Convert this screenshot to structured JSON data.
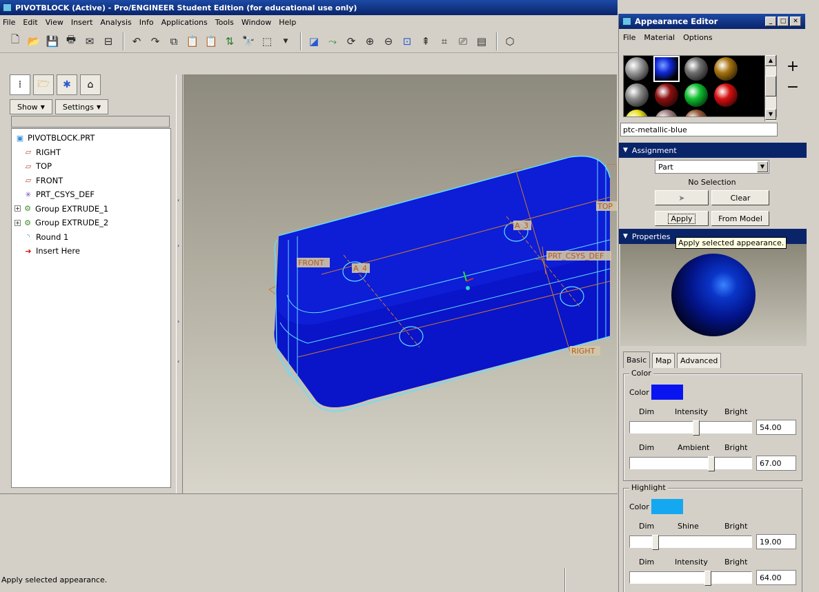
{
  "window": {
    "title": "PIVOTBLOCK (Active) - Pro/ENGINEER Student Edition (for educational use only)",
    "menus": [
      "File",
      "Edit",
      "View",
      "Insert",
      "Analysis",
      "Info",
      "Applications",
      "Tools",
      "Window",
      "Help"
    ]
  },
  "toolbar": {
    "icons": [
      "new-file-icon",
      "open-folder-icon",
      "save-icon",
      "print-icon",
      "email-icon",
      "close-window-icon",
      "undo-icon",
      "redo-icon",
      "copy-icon",
      "paste-icon",
      "paste-special-icon",
      "regenerate-icon",
      "find-icon",
      "select-box-icon",
      "repaint-icon",
      "spin-center-icon",
      "orient-icon",
      "zoom-in-icon",
      "zoom-out-icon",
      "refit-icon",
      "datum-axis-icon",
      "annotation-icon",
      "layer-icon",
      "model-tree-icon"
    ]
  },
  "navigator": {
    "show_label": "Show",
    "settings_label": "Settings",
    "tree": [
      {
        "label": "PIVOTBLOCK.PRT",
        "icon": "part-icon",
        "level": 0,
        "expander": false,
        "color": "#3a8fd9"
      },
      {
        "label": "RIGHT",
        "icon": "datum-plane-icon",
        "level": 1,
        "expander": false,
        "color": "#b8451a"
      },
      {
        "label": "TOP",
        "icon": "datum-plane-icon",
        "level": 1,
        "expander": false,
        "color": "#b8451a"
      },
      {
        "label": "FRONT",
        "icon": "datum-plane-icon",
        "level": 1,
        "expander": false,
        "color": "#b8451a"
      },
      {
        "label": "PRT_CSYS_DEF",
        "icon": "csys-icon",
        "level": 1,
        "expander": false,
        "color": "#7a4fb3"
      },
      {
        "label": "Group EXTRUDE_1",
        "icon": "group-icon",
        "level": 1,
        "expander": true,
        "color": "#3a8f2a"
      },
      {
        "label": "Group EXTRUDE_2",
        "icon": "group-icon",
        "level": 1,
        "expander": true,
        "color": "#3a8f2a"
      },
      {
        "label": "Round 1",
        "icon": "round-icon",
        "level": 1,
        "expander": false,
        "color": "#3a8fd9"
      },
      {
        "label": "Insert Here",
        "icon": "insert-arrow-icon",
        "level": 1,
        "expander": false,
        "color": "#d41818"
      }
    ]
  },
  "graphics": {
    "labels": {
      "front": "FRONT",
      "top": "TOP",
      "right": "RIGHT",
      "csys": "PRT_CSYS_DEF",
      "axis_a3": "A_3",
      "axis_a4": "A_4"
    },
    "part_color": "#0a14c8",
    "edge_color": "#5fe0ff",
    "datum_color": "#c87a3a"
  },
  "status": {
    "message": "Apply selected appearance."
  },
  "appearance_editor": {
    "title": "Appearance Editor",
    "menus": [
      "File",
      "Material",
      "Options"
    ],
    "swatches": [
      "#9c9c9c",
      "#1028d8",
      "#707070",
      "#a87410",
      "#8a8a8a",
      "#8c1010",
      "#10c030",
      "#d81010",
      "#e8e020",
      "#a08080",
      "#9a5a3a"
    ],
    "selected_name": "ptc-metallic-blue",
    "assignment_header": "Assignment",
    "assignment_value": "Part",
    "no_selection": "No Selection",
    "clear_label": "Clear",
    "apply_label": "Apply",
    "from_model_label": "From Model",
    "tooltip": "Apply selected appearance.",
    "properties_header": "Properties",
    "tabs": [
      "Basic",
      "Map",
      "Advanced"
    ],
    "color_group": {
      "label": "Color",
      "color_label": "Color",
      "color": "#0a14f0",
      "intensity": {
        "dim": "Dim",
        "name": "Intensity",
        "bright": "Bright",
        "value": "54.00",
        "fraction": 0.54
      },
      "ambient": {
        "dim": "Dim",
        "name": "Ambient",
        "bright": "Bright",
        "value": "67.00",
        "fraction": 0.67
      }
    },
    "highlight_group": {
      "label": "Highlight",
      "color_label": "Color",
      "color": "#14a8f0",
      "shine": {
        "dim": "Dim",
        "name": "Shine",
        "bright": "Bright",
        "value": "19.00",
        "fraction": 0.19
      },
      "intensity": {
        "dim": "Dim",
        "name": "Intensity",
        "bright": "Bright",
        "value": "64.00",
        "fraction": 0.64
      }
    }
  }
}
